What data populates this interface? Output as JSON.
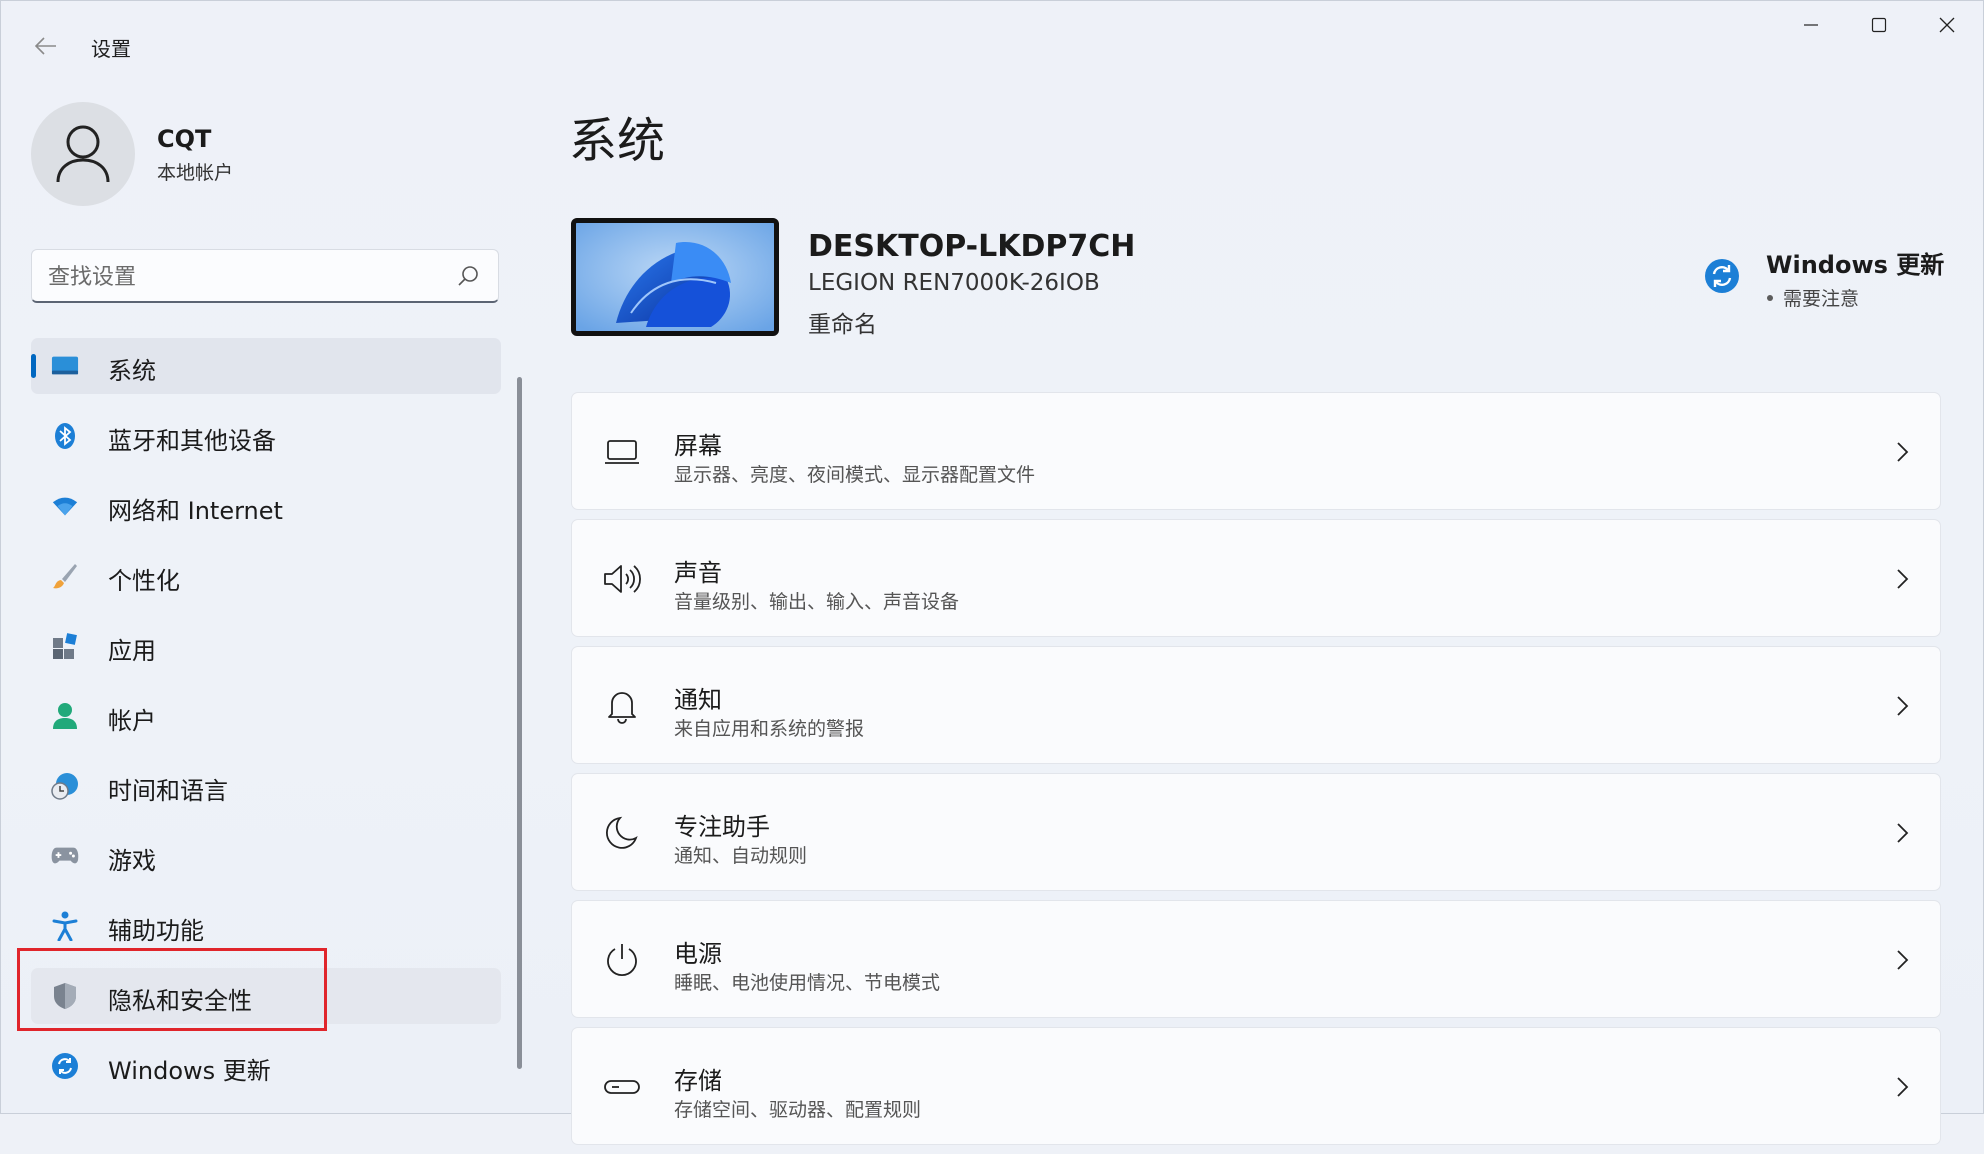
{
  "app": {
    "title": "设置"
  },
  "profile": {
    "name": "CQT",
    "account_type": "本地帐户"
  },
  "search": {
    "placeholder": "查找设置",
    "value": ""
  },
  "nav": {
    "items": [
      {
        "label": "系统",
        "icon": "system-icon",
        "selected": true
      },
      {
        "label": "蓝牙和其他设备",
        "icon": "bluetooth-icon"
      },
      {
        "label": "网络和 Internet",
        "icon": "wifi-icon"
      },
      {
        "label": "个性化",
        "icon": "brush-icon"
      },
      {
        "label": "应用",
        "icon": "apps-icon"
      },
      {
        "label": "帐户",
        "icon": "person-icon"
      },
      {
        "label": "时间和语言",
        "icon": "globe-clock-icon"
      },
      {
        "label": "游戏",
        "icon": "gamepad-icon"
      },
      {
        "label": "辅助功能",
        "icon": "accessibility-icon"
      },
      {
        "label": "隐私和安全性",
        "icon": "shield-icon",
        "highlighted": true
      },
      {
        "label": "Windows 更新",
        "icon": "update-icon"
      }
    ]
  },
  "main": {
    "title": "系统",
    "device": {
      "name": "DESKTOP-LKDP7CH",
      "model": "LEGION REN7000K-26IOB",
      "rename_label": "重命名"
    },
    "update": {
      "title": "Windows 更新",
      "status": "需要注意"
    },
    "cards": [
      {
        "title": "屏幕",
        "subtitle": "显示器、亮度、夜间模式、显示器配置文件",
        "icon": "laptop-icon"
      },
      {
        "title": "声音",
        "subtitle": "音量级别、输出、输入、声音设备",
        "icon": "speaker-icon"
      },
      {
        "title": "通知",
        "subtitle": "来自应用和系统的警报",
        "icon": "bell-icon"
      },
      {
        "title": "专注助手",
        "subtitle": "通知、自动规则",
        "icon": "moon-icon"
      },
      {
        "title": "电源",
        "subtitle": "睡眠、电池使用情况、节电模式",
        "icon": "power-icon"
      },
      {
        "title": "存储",
        "subtitle": "存储空间、驱动器、配置规则",
        "icon": "storage-icon"
      }
    ]
  },
  "colors": {
    "accent": "#0067c0",
    "highlight_border": "#e0252b",
    "background": "#eef1f7"
  }
}
